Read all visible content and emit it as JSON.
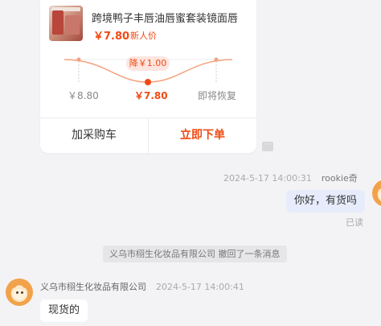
{
  "product_card": {
    "title": "跨境鸭子丰唇油唇蜜套装镜面唇",
    "price": "￥7.80",
    "tag": "新人价",
    "price_drop": "降￥1.00",
    "points": {
      "original": "￥8.80",
      "current": "￥7.80",
      "future": "即将恢复"
    },
    "actions": {
      "add_to_cart": "加采购车",
      "buy_now": "立即下单"
    }
  },
  "messages": {
    "outgoing": {
      "timestamp": "2024-5-17 14:00:31",
      "sender": "rookie奇",
      "text": "你好，有货吗",
      "status": "已读"
    },
    "system_notice": "义乌市栩生化妆品有限公司 撤回了一条消息",
    "incoming": {
      "sender": "义乌市栩生化妆品有限公司",
      "timestamp": "2024-5-17 14:00:41",
      "text": "现货的"
    }
  },
  "colors": {
    "accent": "#f04a13",
    "bubble_out": "#e6ecfb",
    "background": "#f3f3f5"
  },
  "icons": [
    "more-options-icon",
    "user-avatar-icon",
    "seller-avatar-icon"
  ]
}
